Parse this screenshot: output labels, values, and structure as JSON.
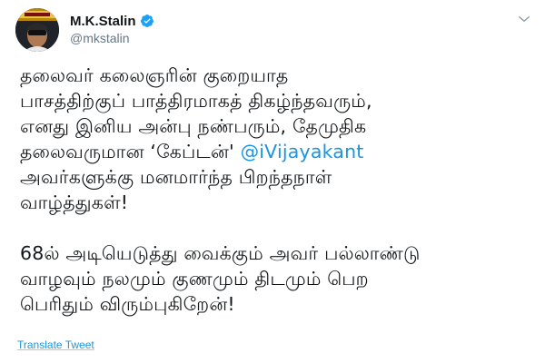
{
  "author": {
    "display_name": "M.K.Stalin",
    "handle": "@mkstalin",
    "verified": true,
    "avatar_icon": "profile-photo"
  },
  "tweet": {
    "paragraph1": {
      "line1": "தலைவர் கலைஞரின் குறையாத",
      "line2": "பாசத்திற்குப் பாத்திரமாகத் திகழ்ந்தவரும்,",
      "line3": "எனது இனிய அன்பு நண்பரும், தேமுதிக",
      "line4_before": "தலைவருமான ‘கேப்டன்' ",
      "mention": "@iVijayakant",
      "line5": "அவர்களுக்கு மனமார்ந்த பிறந்தநாள்",
      "line6": "வாழ்த்துகள்!"
    },
    "paragraph2": {
      "line1": "68ல் அடியெடுத்து வைக்கும் அவர் பல்லாண்டு",
      "line2": "வாழவும் நலமும் குணமும் திடமும் பெற",
      "line3": "பெரிதும் விரும்புகிறேன்!"
    }
  },
  "actions": {
    "translate_label": "Translate Tweet",
    "menu_icon": "chevron-down-icon"
  },
  "colors": {
    "link": "#1b95e0",
    "text": "#14171a",
    "secondary": "#657786",
    "verified": "#1da1f2"
  }
}
